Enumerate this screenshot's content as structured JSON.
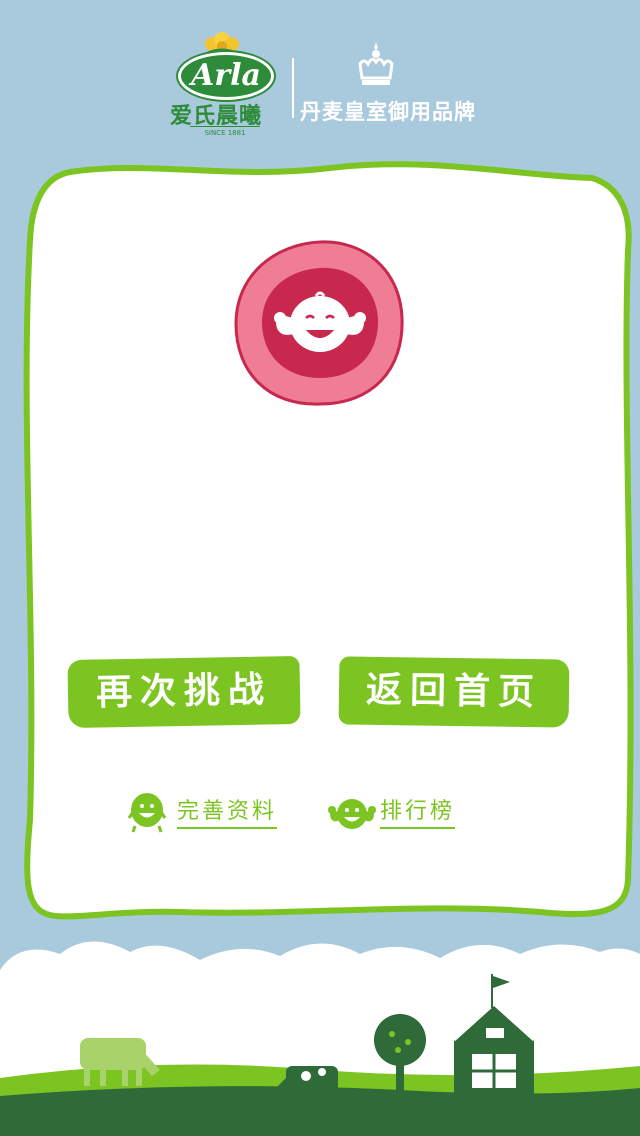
{
  "header": {
    "brand_word": "Arla",
    "brand_chinese": "爱氏晨曦",
    "brand_since": "SINCE 1881",
    "royal_label": "丹麦皇室御用品牌"
  },
  "actions": {
    "retry_label": "再次挑战",
    "home_label": "返回首页"
  },
  "links": {
    "profile_label": "完善资料",
    "leaderboard_label": "排行榜"
  },
  "icons": {
    "crown": "crown-icon",
    "mascot": "strong-mascot-icon",
    "profile": "round-mascot-icon",
    "leaderboard": "flexing-mascot-icon"
  },
  "colors": {
    "sky": "#a9c9dc",
    "accent_green": "#7cc422",
    "card": "#ffffff",
    "badge_outer": "#ef7d93",
    "badge_inner": "#c8284e",
    "farm_green": "#2f6b38"
  }
}
